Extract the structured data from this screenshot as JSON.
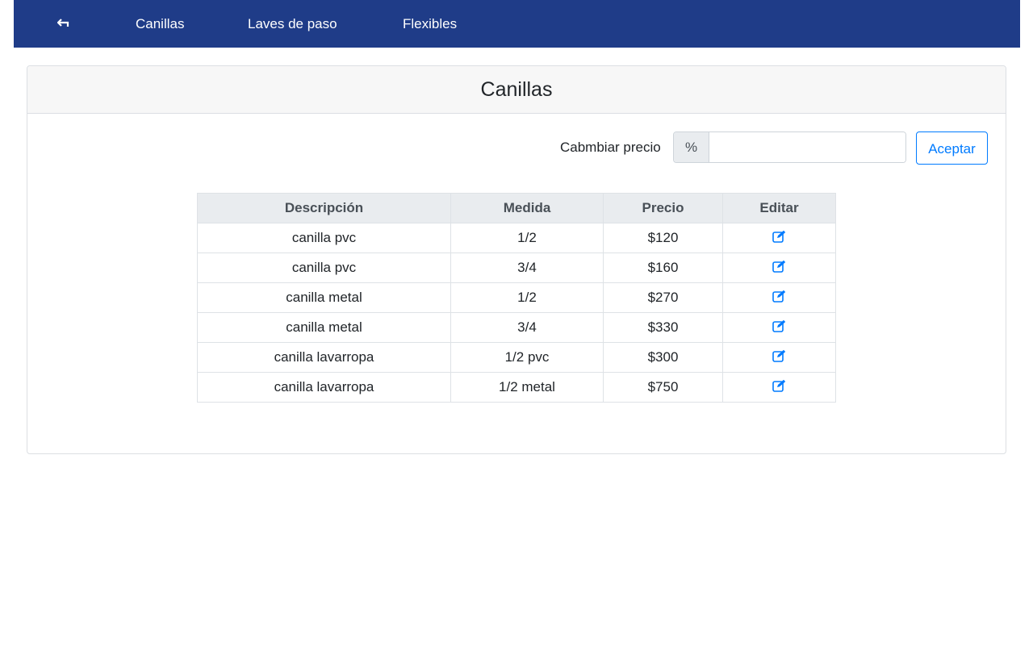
{
  "nav": {
    "back_icon": "back-arrow-icon",
    "items": [
      {
        "label": "Canillas"
      },
      {
        "label": "Laves de paso"
      },
      {
        "label": "Flexibles"
      }
    ],
    "color": "#1f3c88"
  },
  "card": {
    "title": "Canillas"
  },
  "price_form": {
    "label": "Cabmbiar precio",
    "prefix": "%",
    "value": "",
    "placeholder": "",
    "accept_label": "Aceptar"
  },
  "table": {
    "headers": [
      "Descripción",
      "Medida",
      "Precio",
      "Editar"
    ],
    "edit_icon": "edit-icon",
    "rows": [
      {
        "descripcion": "canilla pvc",
        "medida": "1/2",
        "precio": "$120"
      },
      {
        "descripcion": "canilla pvc",
        "medida": "3/4",
        "precio": "$160"
      },
      {
        "descripcion": "canilla metal",
        "medida": "1/2",
        "precio": "$270"
      },
      {
        "descripcion": "canilla metal",
        "medida": "3/4",
        "precio": "$330"
      },
      {
        "descripcion": "canilla lavarropa",
        "medida": "1/2 pvc",
        "precio": "$300"
      },
      {
        "descripcion": "canilla lavarropa",
        "medida": "1/2 metal",
        "precio": "$750"
      }
    ]
  },
  "colors": {
    "primary": "#007bff",
    "navbar": "#1f3c88"
  }
}
